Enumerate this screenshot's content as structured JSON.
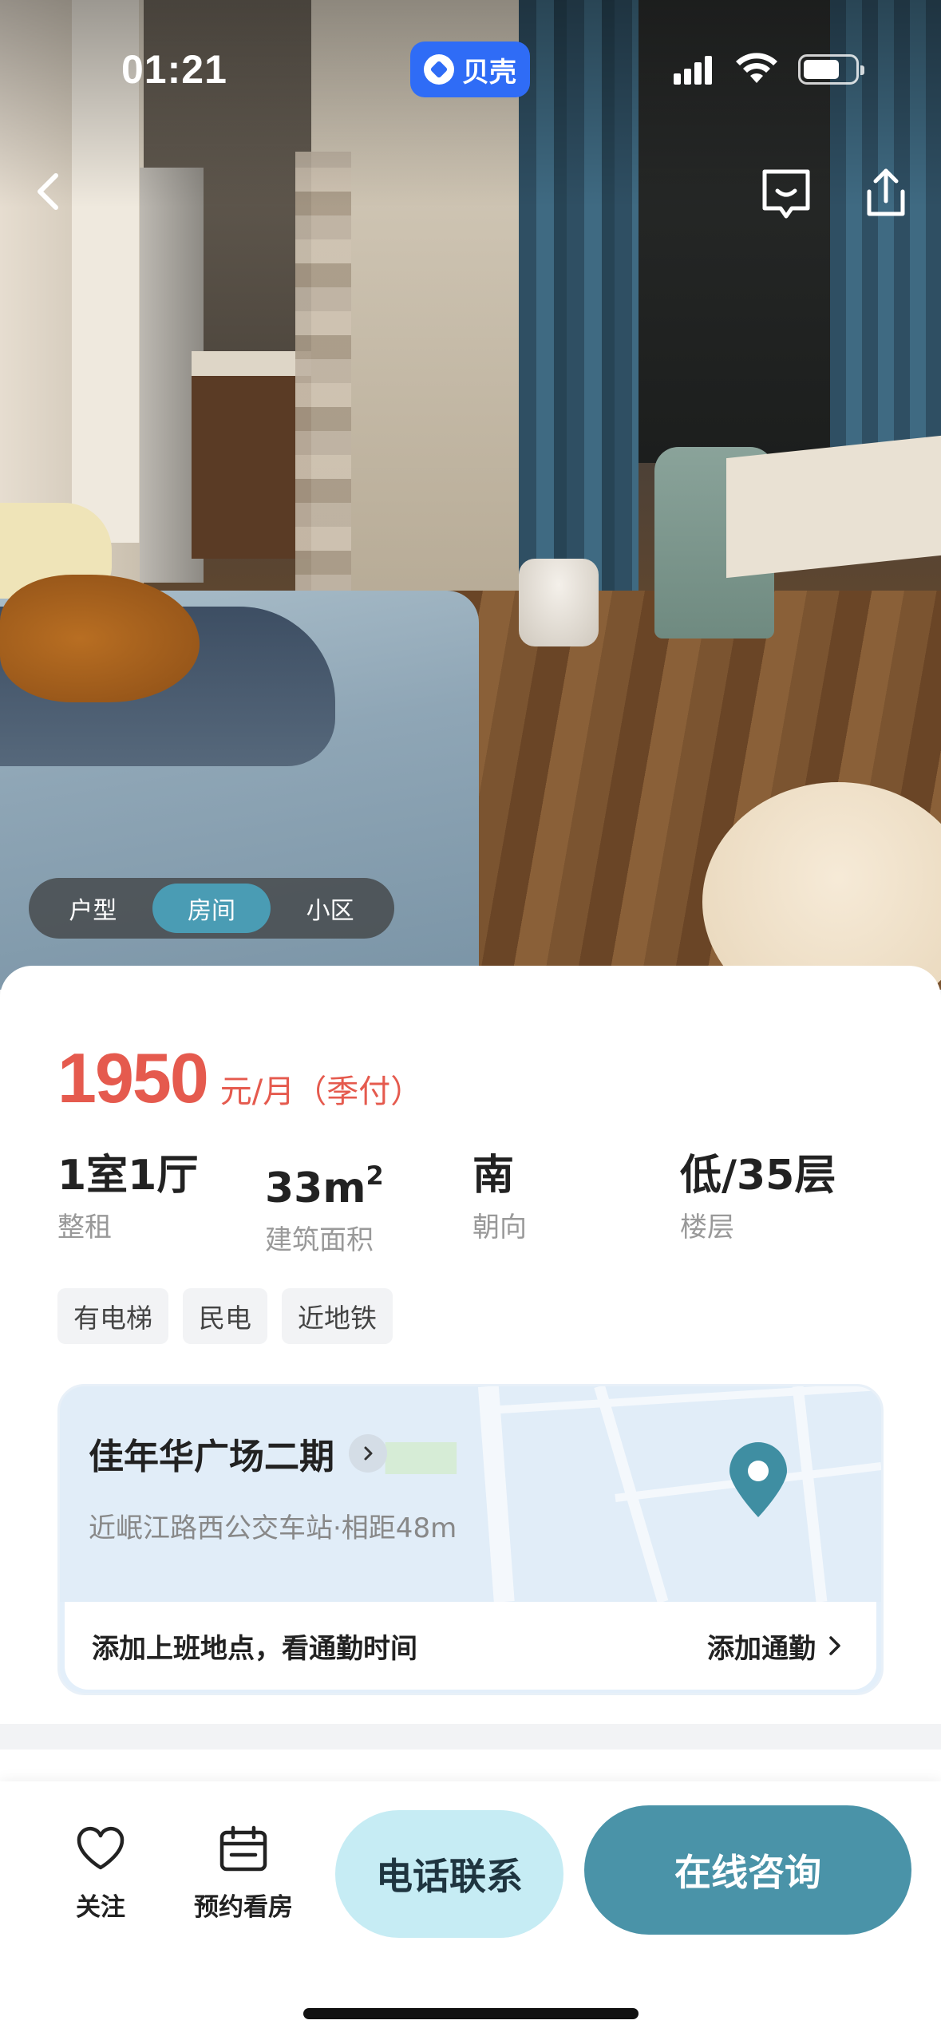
{
  "status_bar": {
    "time": "01:21",
    "app_pill": "贝壳"
  },
  "photo_tabs": [
    "户型",
    "房间",
    "小区"
  ],
  "photo_tab_active": "房间",
  "listing": {
    "price": "1950",
    "price_unit": "元/月（季付）",
    "specs": [
      {
        "value": "1室1厅",
        "label": "整租"
      },
      {
        "value": "33m",
        "sup": "2",
        "label": "建筑面积"
      },
      {
        "value": "南",
        "label": "朝向"
      },
      {
        "value": "低/35层",
        "label": "楼层"
      }
    ],
    "tags": [
      "有电梯",
      "民电",
      "近地铁"
    ]
  },
  "community": {
    "name": "佳年华广场二期",
    "subtitle": "近岷江路西公交车站·相距48m",
    "commute_text": "添加上班地点，看通勤时间",
    "commute_link": "添加通勤"
  },
  "bottom_bar": {
    "follow_label": "关注",
    "visit_label": "预约看房",
    "phone_label": "电话联系",
    "chat_label": "在线咨询"
  },
  "colors": {
    "price": "#e55a4e",
    "accent": "#4a93a8",
    "phone_btn": "#c6ecf4",
    "pill": "#2f6cf6"
  },
  "icons": [
    "back-icon",
    "message-icon",
    "share-icon",
    "location-pin-icon",
    "chevron-right-icon",
    "heart-icon",
    "calendar-icon"
  ]
}
